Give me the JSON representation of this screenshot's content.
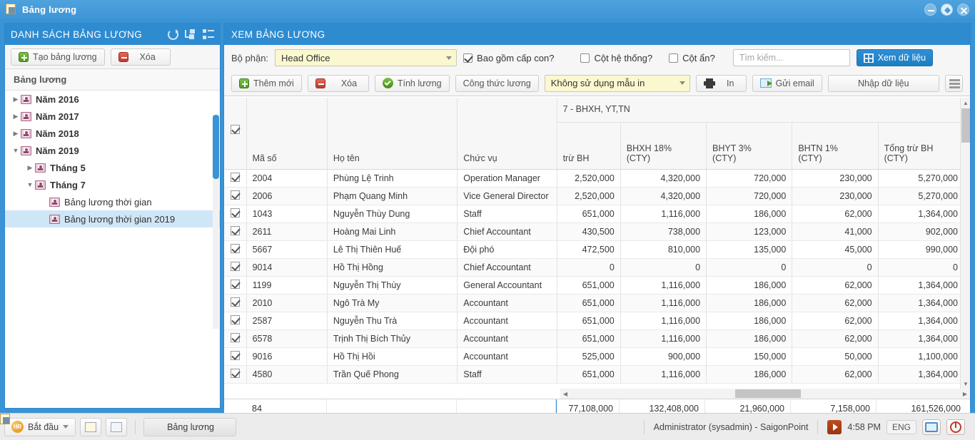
{
  "window": {
    "title": "Bảng lương",
    "icon": "report-icon",
    "buttons": [
      {
        "name": "minimize-button",
        "icon": "minimize-icon"
      },
      {
        "name": "restore-button",
        "icon": "restore-icon"
      },
      {
        "name": "close-button",
        "icon": "close-icon"
      }
    ]
  },
  "left_panel": {
    "header": "DANH SÁCH BẢNG LƯƠNG",
    "header_icons": [
      "refresh-icon",
      "collapse-all-icon",
      "expand-all-icon"
    ],
    "toolbar": {
      "create_label": "Tạo bảng lương",
      "delete_label": "Xóa"
    },
    "section_label": "Bảng lương",
    "tree": [
      {
        "label": "Năm 2016",
        "depth": 0,
        "state": "collapsed",
        "selected": false
      },
      {
        "label": "Năm 2017",
        "depth": 0,
        "state": "collapsed",
        "selected": false
      },
      {
        "label": "Năm 2018",
        "depth": 0,
        "state": "collapsed",
        "selected": false
      },
      {
        "label": "Năm 2019",
        "depth": 0,
        "state": "expanded",
        "selected": false
      },
      {
        "label": "Tháng 5",
        "depth": 1,
        "state": "collapsed",
        "selected": false
      },
      {
        "label": "Tháng 7",
        "depth": 1,
        "state": "expanded",
        "selected": false
      },
      {
        "label": "Bảng lương thời gian",
        "depth": 2,
        "state": "leaf",
        "selected": false
      },
      {
        "label": "Bảng lương thời gian 2019",
        "depth": 2,
        "state": "leaf",
        "selected": true
      }
    ]
  },
  "right_panel": {
    "header": "XEM BẢNG LƯƠNG",
    "filter": {
      "department_label": "Bộ phận:",
      "department_value": "Head Office",
      "include_children_label": "Bao gồm cấp con?",
      "include_children_checked": true,
      "system_columns_label": "Cột hệ thống?",
      "system_columns_checked": false,
      "hidden_columns_label": "Cột ẩn?",
      "hidden_columns_checked": false,
      "search_placeholder": "Tìm kiếm...",
      "search_value": "",
      "view_data_label": "Xem dữ liệu"
    },
    "toolbar": {
      "add_label": "Thêm mới",
      "delete_label": "Xóa",
      "calculate_label": "Tính lương",
      "formula_label": "Công thức lương",
      "print_template_value": "Không sử dụng mẫu in",
      "print_label": "In",
      "email_label": "Gửi email",
      "import_label": "Nhập dữ liệu",
      "menu_icon": "hamburger-menu-icon"
    },
    "grid": {
      "group_header": "7 - BHXH, YT,TN",
      "columns": [
        {
          "key": "check",
          "label": ""
        },
        {
          "key": "code",
          "label": "Mã số"
        },
        {
          "key": "name",
          "label": "Họ tên"
        },
        {
          "key": "position",
          "label": "Chức vụ"
        },
        {
          "key": "trubh",
          "label": "trừ BH"
        },
        {
          "key": "bhxh",
          "label": "BHXH 18%\n(CTY)"
        },
        {
          "key": "bhyt",
          "label": "BHYT 3%\n(CTY)"
        },
        {
          "key": "bhtn",
          "label": "BHTN 1%\n(CTY)"
        },
        {
          "key": "tong",
          "label": "Tổng trừ BH\n(CTY)"
        }
      ],
      "rows": [
        {
          "checked": true,
          "code": "2004",
          "name": "Phùng Lệ Trinh",
          "position": "Operation Manager",
          "trubh": "2,520,000",
          "bhxh": "4,320,000",
          "bhyt": "720,000",
          "bhtn": "230,000",
          "tong": "5,270,000"
        },
        {
          "checked": true,
          "code": "2006",
          "name": "Phạm Quang Minh",
          "position": "Vice General Director",
          "trubh": "2,520,000",
          "bhxh": "4,320,000",
          "bhyt": "720,000",
          "bhtn": "230,000",
          "tong": "5,270,000"
        },
        {
          "checked": true,
          "code": "1043",
          "name": "Nguyễn Thùy Dung",
          "position": "Staff",
          "trubh": "651,000",
          "bhxh": "1,116,000",
          "bhyt": "186,000",
          "bhtn": "62,000",
          "tong": "1,364,000"
        },
        {
          "checked": true,
          "code": "2611",
          "name": "Hoàng Mai Linh",
          "position": "Chief Accountant",
          "trubh": "430,500",
          "bhxh": "738,000",
          "bhyt": "123,000",
          "bhtn": "41,000",
          "tong": "902,000"
        },
        {
          "checked": true,
          "code": "5667",
          "name": "Lê Thị Thiên Huế",
          "position": "Đội phó",
          "trubh": "472,500",
          "bhxh": "810,000",
          "bhyt": "135,000",
          "bhtn": "45,000",
          "tong": "990,000"
        },
        {
          "checked": true,
          "code": "9014",
          "name": "Hồ Thị Hồng",
          "position": "Chief Accountant",
          "trubh": "0",
          "bhxh": "0",
          "bhyt": "0",
          "bhtn": "0",
          "tong": "0"
        },
        {
          "checked": true,
          "code": "1199",
          "name": "Nguyễn Thị Thùy",
          "position": "General Accountant",
          "trubh": "651,000",
          "bhxh": "1,116,000",
          "bhyt": "186,000",
          "bhtn": "62,000",
          "tong": "1,364,000"
        },
        {
          "checked": true,
          "code": "2010",
          "name": "Ngô Trà My",
          "position": "Accountant",
          "trubh": "651,000",
          "bhxh": "1,116,000",
          "bhyt": "186,000",
          "bhtn": "62,000",
          "tong": "1,364,000"
        },
        {
          "checked": true,
          "code": "2587",
          "name": "Nguyễn Thu Trà",
          "position": "Accountant",
          "trubh": "651,000",
          "bhxh": "1,116,000",
          "bhyt": "186,000",
          "bhtn": "62,000",
          "tong": "1,364,000"
        },
        {
          "checked": true,
          "code": "6578",
          "name": "Trịnh Thị Bích Thủy",
          "position": "Accountant",
          "trubh": "651,000",
          "bhxh": "1,116,000",
          "bhyt": "186,000",
          "bhtn": "62,000",
          "tong": "1,364,000"
        },
        {
          "checked": true,
          "code": "9016",
          "name": "Hồ Thị Hồi",
          "position": "Accountant",
          "trubh": "525,000",
          "bhxh": "900,000",
          "bhyt": "150,000",
          "bhtn": "50,000",
          "tong": "1,100,000"
        },
        {
          "checked": true,
          "code": "4580",
          "name": "Trần Quế Phong",
          "position": "Staff",
          "trubh": "651,000",
          "bhxh": "1,116,000",
          "bhyt": "186,000",
          "bhtn": "62,000",
          "tong": "1,364,000"
        }
      ],
      "footer": {
        "count": "84",
        "trubh": "77,108,000",
        "bhxh": "132,408,000",
        "bhyt": "21,960,000",
        "bhtn": "7,158,000",
        "tong": "161,526,000"
      }
    }
  },
  "taskbar": {
    "start_label": "Bắt đầu",
    "start_icon": "hr-logo-icon",
    "quick_icons": [
      "report-shortcut-icon",
      "list-shortcut-icon"
    ],
    "task_item": "Bảng lương",
    "user": "Administrator (sysadmin) - SaigonPoint",
    "time": "4:58 PM",
    "language": "ENG",
    "tray_icons": [
      "media-icon",
      "monitor-icon",
      "power-icon"
    ]
  }
}
